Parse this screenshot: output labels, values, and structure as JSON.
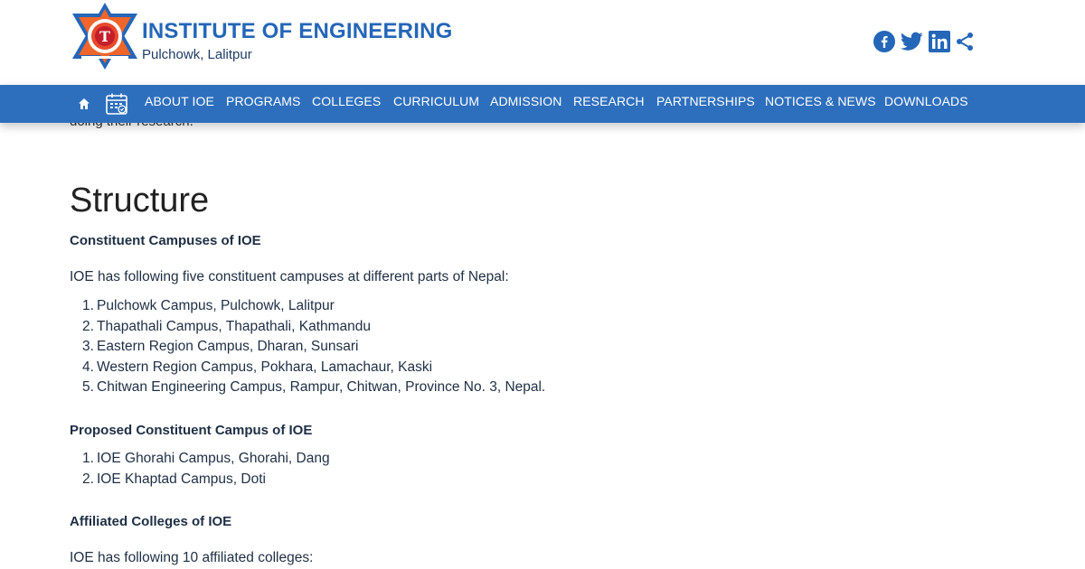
{
  "header": {
    "title": "INSTITUTE OF ENGINEERING",
    "subtitle": "Pulchowk, Lalitpur",
    "logo_icon": "ioe-star-logo-icon",
    "social_icons": [
      "facebook-icon",
      "twitter-icon",
      "linkedin-icon",
      "share-icon"
    ],
    "colors": {
      "brand_blue": "#2466b8",
      "logo_orange": "#f0652a",
      "nav_blue": "#2e6fbd"
    }
  },
  "nav": {
    "home_icon": "home-icon",
    "calendar_icon": "calendar-icon",
    "items": [
      "ABOUT IOE",
      "PROGRAMS",
      "COLLEGES",
      "CURRICULUM",
      "ADMISSION",
      "RESEARCH",
      "PARTNERSHIPS",
      "NOTICES & NEWS",
      "DOWNLOADS"
    ]
  },
  "main": {
    "clipped_text": "doing their research.",
    "heading": "Structure",
    "sections": [
      {
        "subheading": "Constituent Campuses of IOE",
        "intro": "IOE has following five constituent campuses at different parts of Nepal:",
        "items": [
          "Pulchowk Campus, Pulchowk, Lalitpur",
          "Thapathali Campus, Thapathali, Kathmandu",
          "Eastern Region Campus, Dharan, Sunsari",
          "Western Region Campus, Pokhara, Lamachaur, Kaski",
          "Chitwan Engineering Campus, Rampur, Chitwan, Province No. 3, Nepal."
        ]
      },
      {
        "subheading": "Proposed Constituent Campus of IOE",
        "items": [
          "IOE Ghorahi Campus, Ghorahi, Dang",
          "IOE Khaptad Campus, Doti"
        ]
      },
      {
        "subheading": "Affiliated Colleges of IOE",
        "intro": "IOE has following 10 affiliated colleges:"
      }
    ]
  }
}
